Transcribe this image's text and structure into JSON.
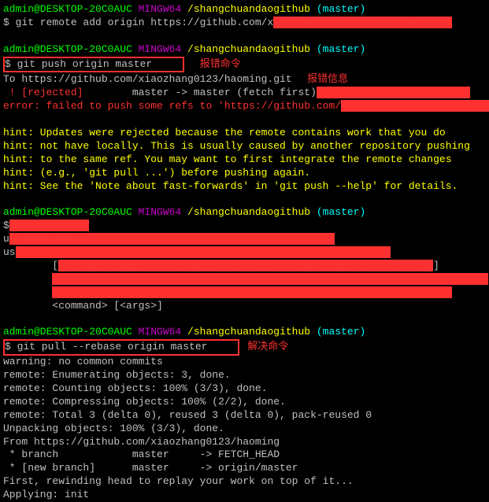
{
  "prompt1": {
    "user": "admin@DESKTOP-20C0AUC",
    "env": " MINGW64",
    "path": " /shangchuandaogithub",
    "branch": " (master)"
  },
  "cmd1": "$ git remote add origin https://github.com/x",
  "cmd2": "$ git push origin master     ",
  "annot_cmd": "  　报错命令",
  "out2_line1a": "To https://github.com/xiaozhang0123/haoming.git",
  "annot_info": "　  报错信息",
  "out2_reject_a": " ! [rejected]",
  "out2_reject_b": "        master -> master (fetch first)",
  "out2_err": "error: failed to push some refs to 'https://github.com/",
  "out2_err_end": "'",
  "hints": [
    "hint: Updates were rejected because the remote contains work that you do",
    "hint: not have locally. This is usually caused by another repository pushing",
    "hint: to the same ref. You may want to first integrate the remote changes",
    "hint: (e.g., 'git pull ...') before pushing again.",
    "hint: See the 'Note about fast-forwards' in 'git push --help' for details."
  ],
  "cmd3": "$",
  "usage_u": "u",
  "usage_us": "us",
  "usage_bracket1": "        [",
  "usage_bracket2": "        ",
  "usage_bracket3": "        ",
  "usage_cmd": "        <command> [<args>]",
  "cmd4": "$ git pull --rebase origin master     ",
  "annot_fix": "   解决命令",
  "warn": "warning: no common commits",
  "pull_out": [
    "remote: Enumerating objects: 3, done.",
    "remote: Counting objects: 100% (3/3), done.",
    "remote: Compressing objects: 100% (2/2), done.",
    "remote: Total 3 (delta 0), reused 3 (delta 0), pack-reused 0",
    "Unpacking objects: 100% (3/3), done.",
    "From https://github.com/xiaozhang0123/haoming",
    " * branch            master     -> FETCH_HEAD",
    " * [new branch]      master     -> origin/master",
    "First, rewinding head to replay your work on top of it...",
    "Applying: init"
  ]
}
